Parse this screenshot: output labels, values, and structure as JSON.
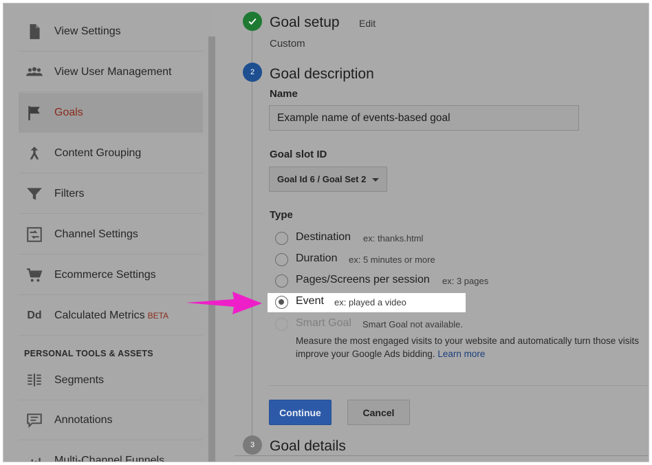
{
  "sidebar": {
    "items": [
      {
        "label": "View Settings",
        "icon": "file-icon"
      },
      {
        "label": "View User Management",
        "icon": "users-icon"
      },
      {
        "label": "Goals",
        "icon": "flag-icon",
        "active": true
      },
      {
        "label": "Content Grouping",
        "icon": "merge-icon"
      },
      {
        "label": "Filters",
        "icon": "filter-icon"
      },
      {
        "label": "Channel Settings",
        "icon": "channel-icon"
      },
      {
        "label": "Ecommerce Settings",
        "icon": "cart-icon"
      },
      {
        "label": "Calculated Metrics",
        "badge": "BETA",
        "icon": "dd-icon",
        "icon_text": "Dd"
      }
    ],
    "section_title": "PERSONAL TOOLS & ASSETS",
    "personal_items": [
      {
        "label": "Segments",
        "icon": "segments-icon"
      },
      {
        "label": "Annotations",
        "icon": "annotation-icon"
      },
      {
        "label": "Multi-Channel Funnels",
        "icon": "funnel-icon"
      }
    ]
  },
  "goal_setup": {
    "title": "Goal setup",
    "edit_label": "Edit",
    "value": "Custom"
  },
  "goal_description": {
    "step": "2",
    "title": "Goal description",
    "name_label": "Name",
    "name_value": "Example name of events-based goal",
    "slot_label": "Goal slot ID",
    "slot_value": "Goal Id 6 / Goal Set 2",
    "type_label": "Type",
    "types": [
      {
        "label": "Destination",
        "example": "ex: thanks.html"
      },
      {
        "label": "Duration",
        "example": "ex: 5 minutes or more"
      },
      {
        "label": "Pages/Screens per session",
        "example": "ex: 3 pages"
      },
      {
        "label": "Event",
        "example": "ex: played a video",
        "selected": true
      },
      {
        "label": "Smart Goal",
        "example": "Smart Goal not available.",
        "disabled": true
      }
    ],
    "smart_goal_desc_1": "Measure the most engaged visits to your website and automatically turn those visits",
    "smart_goal_desc_2": "improve your Google Ads bidding.",
    "learn_more": "Learn more",
    "continue_label": "Continue",
    "cancel_label": "Cancel"
  },
  "goal_details": {
    "step": "3",
    "title": "Goal details"
  },
  "colors": {
    "accent_arrow": "#ee1fc8",
    "continue_button": "#2c5aa8",
    "active_nav": "#8a2b1d",
    "step_done": "#1e7a33"
  }
}
